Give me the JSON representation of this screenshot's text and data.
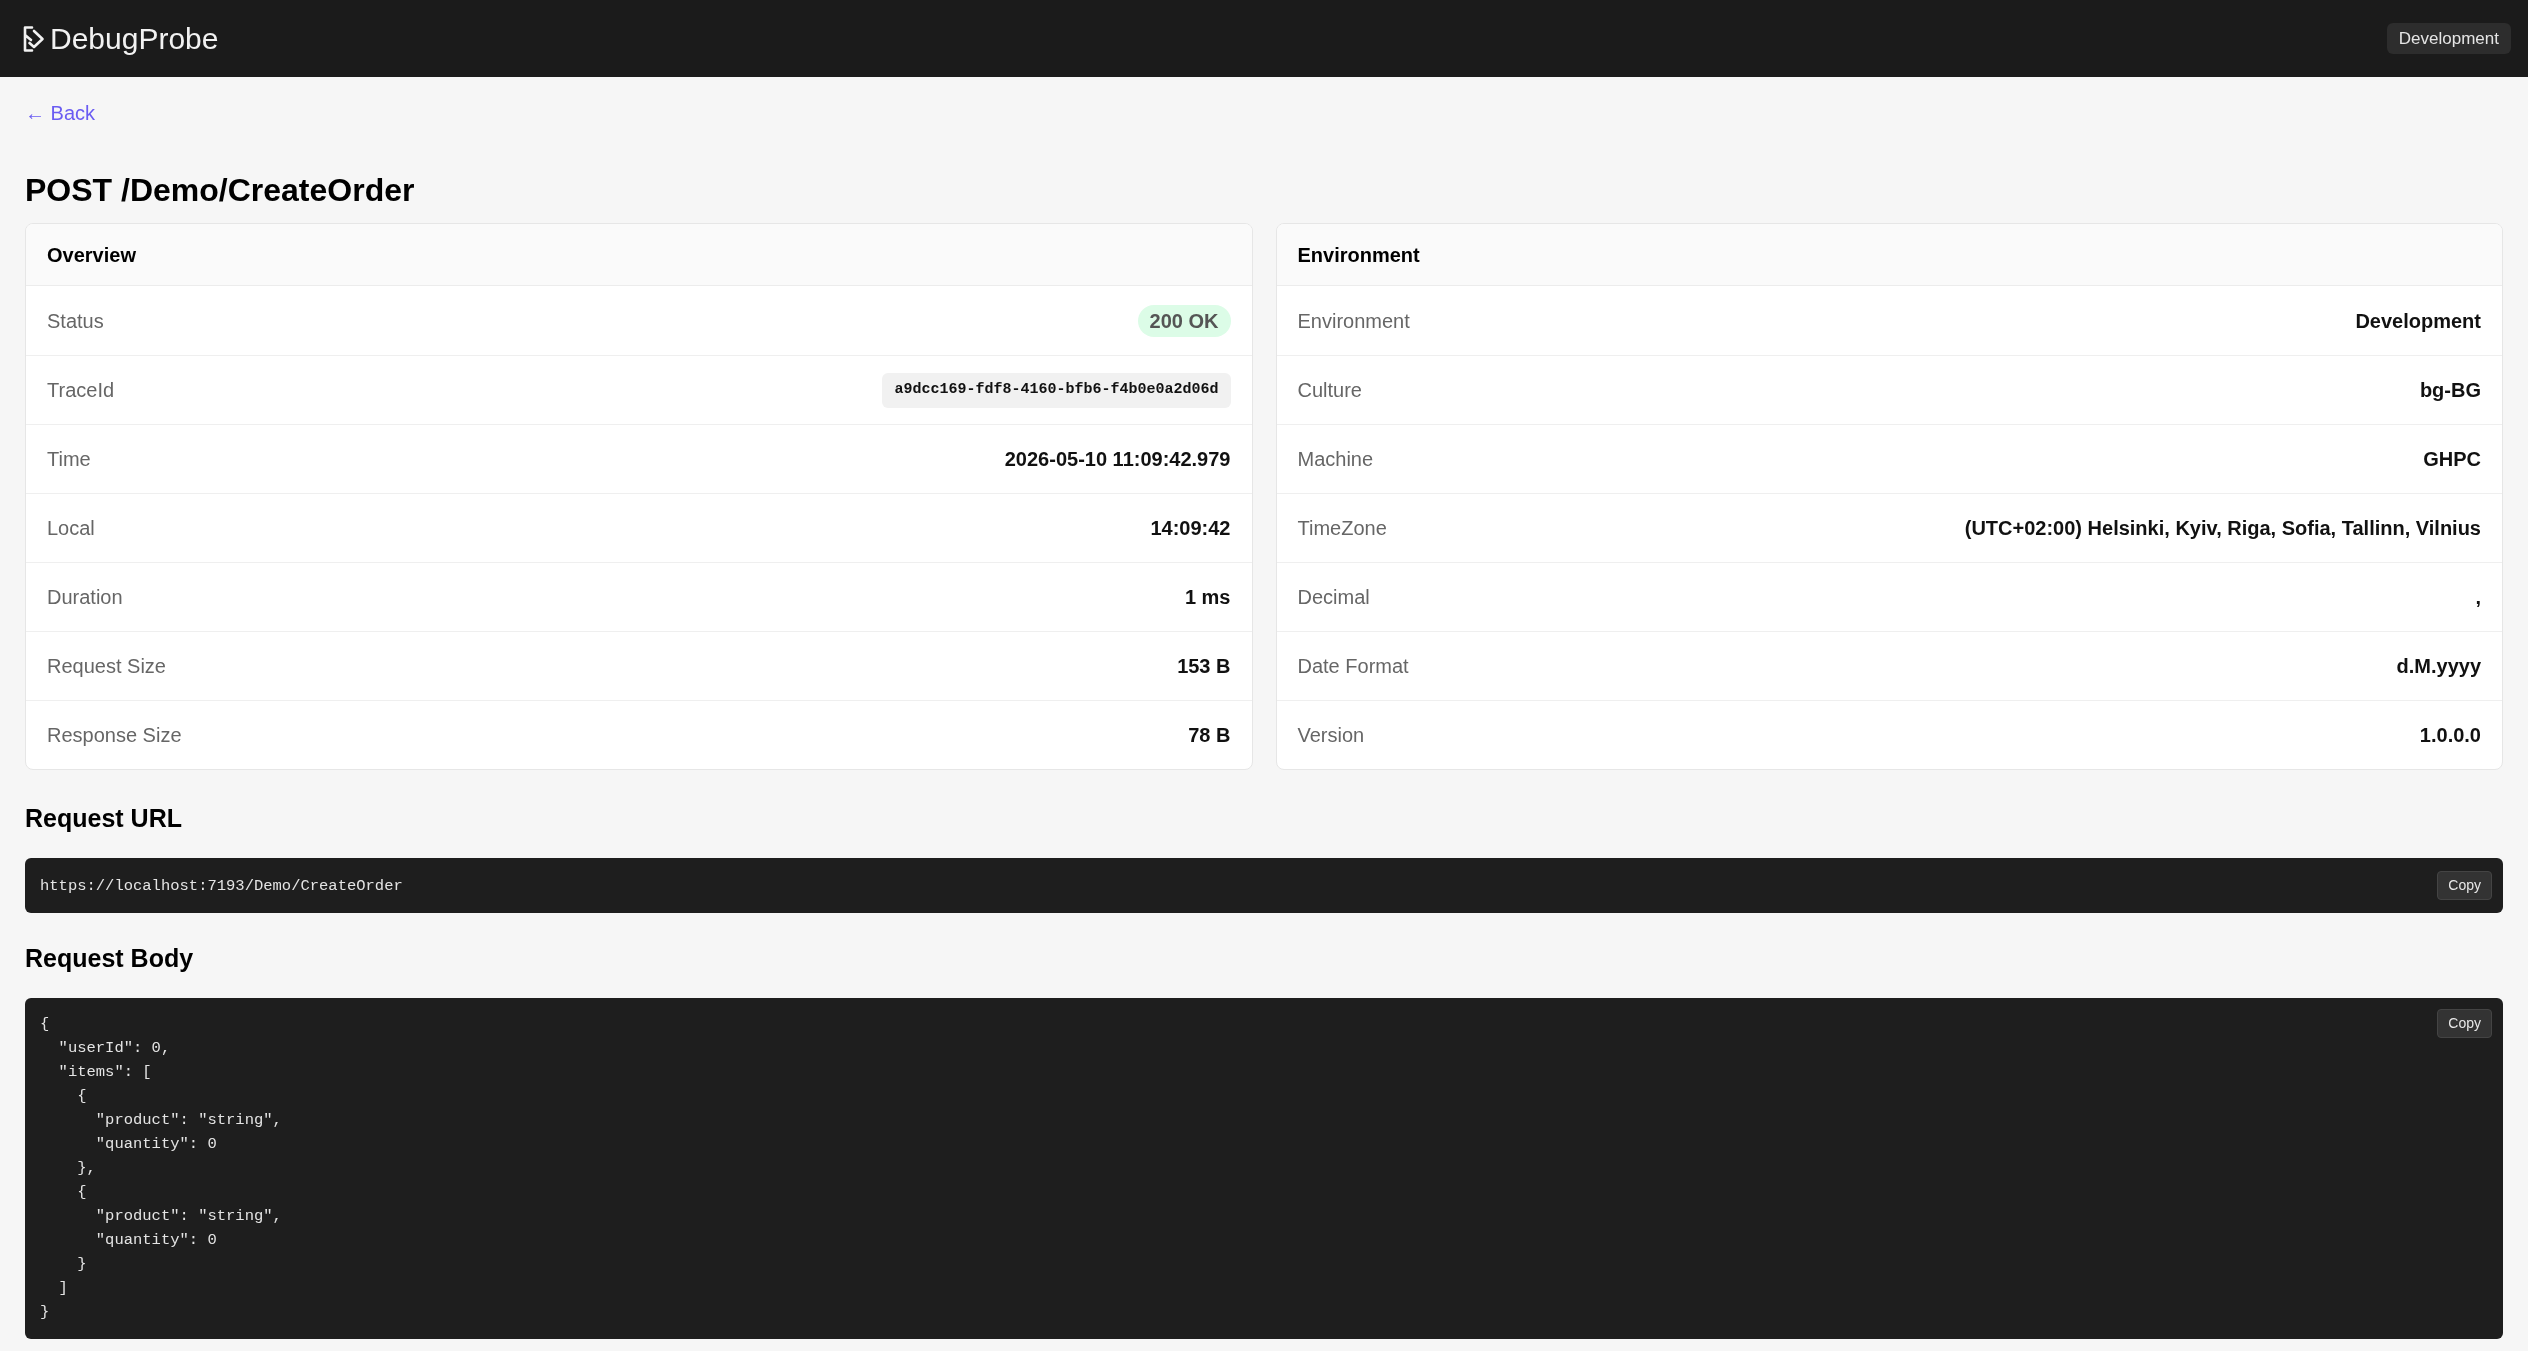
{
  "header": {
    "logo": "DebugProbe",
    "environment_badge": "Development"
  },
  "back_link": "← Back",
  "title": "POST /Demo/CreateOrder",
  "cards": [
    {
      "title": "Overview",
      "rows": [
        {
          "kind": "status",
          "label": "Status",
          "value": "200 OK"
        },
        {
          "kind": "code",
          "label": "TraceId",
          "value": "a9dcc169-fdf8-4160-bfb6-f4b0e0a2d06d"
        },
        {
          "kind": "text",
          "label": "Time",
          "value": "2026-05-10 11:09:42.979"
        },
        {
          "kind": "text",
          "label": "Local",
          "value": "14:09:42"
        },
        {
          "kind": "text",
          "label": "Duration",
          "value": "1 ms"
        },
        {
          "kind": "text",
          "label": "Request Size",
          "value": "153 B"
        },
        {
          "kind": "text",
          "label": "Response Size",
          "value": "78 B"
        }
      ]
    },
    {
      "title": "Environment",
      "rows": [
        {
          "kind": "text",
          "label": "Environment",
          "value": "Development"
        },
        {
          "kind": "text",
          "label": "Culture",
          "value": "bg-BG"
        },
        {
          "kind": "text",
          "label": "Machine",
          "value": "GHPC"
        },
        {
          "kind": "text",
          "label": "TimeZone",
          "value": "(UTC+02:00) Helsinki, Kyiv, Riga, Sofia, Tallinn, Vilnius"
        },
        {
          "kind": "text",
          "label": "Decimal",
          "value": ","
        },
        {
          "kind": "text",
          "label": "Date Format",
          "value": "d.M.yyyy"
        },
        {
          "kind": "text",
          "label": "Version",
          "value": "1.0.0.0"
        }
      ]
    }
  ],
  "sections": [
    {
      "kind": "url",
      "title": "Request URL",
      "content": "https://localhost:7193/Demo/CreateOrder",
      "copy_button": "Copy"
    },
    {
      "kind": "json",
      "title": "Request Body",
      "content": "{\n  \"userId\": 0,\n  \"items\": [\n    {\n      \"product\": \"string\",\n      \"quantity\": 0\n    },\n    {\n      \"product\": \"string\",\n      \"quantity\": 0\n    }\n  ]\n}",
      "copy_button": "Copy"
    }
  ]
}
